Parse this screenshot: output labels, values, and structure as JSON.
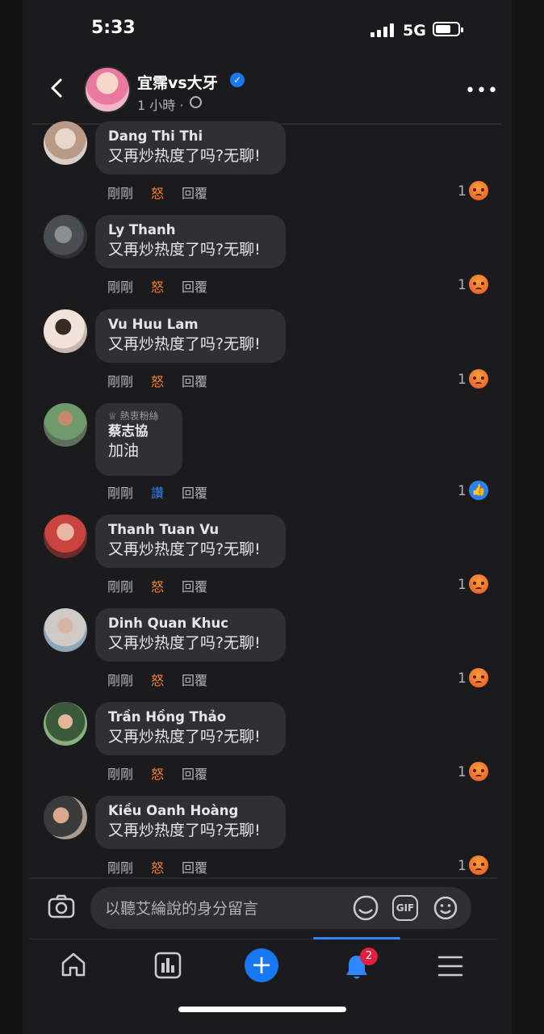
{
  "status_bar": {
    "time": "5:33",
    "network": "5G"
  },
  "header": {
    "page_name": "宜霈vs大牙",
    "post_time": "1 小時 ·"
  },
  "comments": [
    {
      "name": "Dang Thi Thi",
      "text": "又再炒热度了吗?无聊!",
      "time": "剛剛",
      "reaction_label": "怒",
      "reply": "回覆",
      "count": "1",
      "reaction_type": "angry"
    },
    {
      "name": "Ly Thanh",
      "text": "又再炒热度了吗?无聊!",
      "time": "剛剛",
      "reaction_label": "怒",
      "reply": "回覆",
      "count": "1",
      "reaction_type": "angry"
    },
    {
      "name": "Vu Huu Lam",
      "text": "又再炒热度了吗?无聊!",
      "time": "剛剛",
      "reaction_label": "怒",
      "reply": "回覆",
      "count": "1",
      "reaction_type": "angry"
    },
    {
      "badge": "熱衷粉絲",
      "name": "蔡志協",
      "text": "加油",
      "time": "剛剛",
      "reaction_label": "讚",
      "reply": "回覆",
      "count": "1",
      "reaction_type": "like"
    },
    {
      "name": "Thanh Tuan Vu",
      "text": "又再炒热度了吗?无聊!",
      "time": "剛剛",
      "reaction_label": "怒",
      "reply": "回覆",
      "count": "1",
      "reaction_type": "angry"
    },
    {
      "name": "Dinh Quan Khuc",
      "text": "又再炒热度了吗?无聊!",
      "time": "剛剛",
      "reaction_label": "怒",
      "reply": "回覆",
      "count": "1",
      "reaction_type": "angry"
    },
    {
      "name": "Trần Hồng Thảo",
      "text": "又再炒热度了吗?无聊!",
      "time": "剛剛",
      "reaction_label": "怒",
      "reply": "回覆",
      "count": "1",
      "reaction_type": "angry"
    },
    {
      "name": "Kiều Oanh Hoàng",
      "text": "又再炒热度了吗?无聊!",
      "time": "剛剛",
      "reaction_label": "怒",
      "reply": "回覆",
      "count": "1",
      "reaction_type": "angry"
    }
  ],
  "composer": {
    "placeholder": "以聽艾綸說的身分留言",
    "gif_label": "GIF"
  },
  "bottom_nav": {
    "notification_count": "2",
    "active_tab": "notifications"
  },
  "colors": {
    "accent": "#1877f2",
    "angry": "#f07d2c",
    "like": "#2f7fe6",
    "badge": "#e41e3f",
    "background": "#1b1b1d",
    "bubble": "#303033"
  },
  "icons": [
    "back-icon",
    "verified-icon",
    "globe-icon",
    "more-icon",
    "camera-icon",
    "sticker-icon",
    "gif-icon",
    "emoji-icon",
    "home-icon",
    "dashboard-icon",
    "create-icon",
    "bell-icon",
    "menu-icon"
  ]
}
